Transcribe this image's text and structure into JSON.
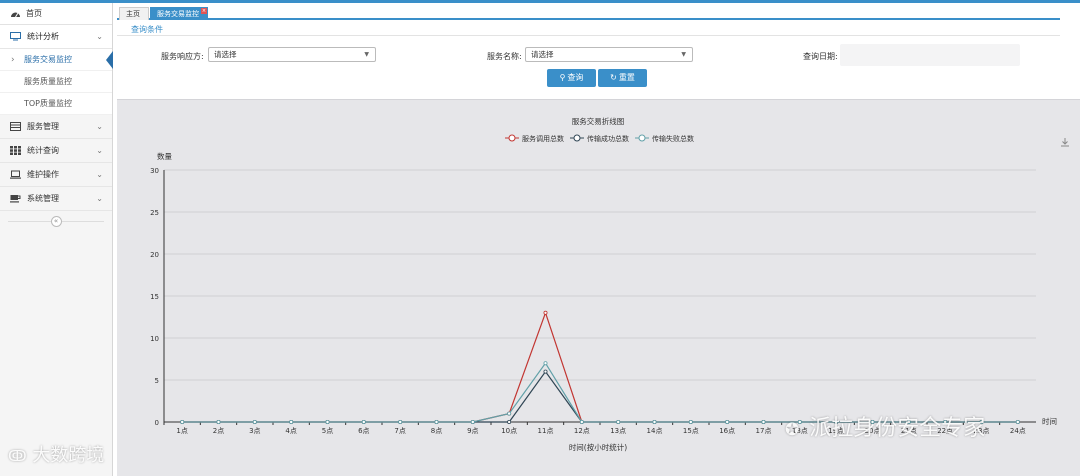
{
  "sidebar": {
    "home": "首页",
    "groups": [
      {
        "label": "统计分析",
        "icon": "monitor-icon",
        "expanded": true,
        "items": [
          "服务交易监控",
          "服务质量监控",
          "TOP质量监控"
        ]
      },
      {
        "label": "服务管理",
        "icon": "table-icon"
      },
      {
        "label": "统计查询",
        "icon": "grid-icon"
      },
      {
        "label": "维护操作",
        "icon": "laptop-icon"
      },
      {
        "label": "系统管理",
        "icon": "coffee-cup-icon"
      }
    ],
    "collapse": "«"
  },
  "tabs": [
    {
      "label": "主页"
    },
    {
      "label": "服务交易监控",
      "active": true,
      "close": "×"
    }
  ],
  "query": {
    "section_title": "查询条件",
    "responder_label": "服务响应方:",
    "responder_value": "请选择",
    "service_label": "服务名称:",
    "service_value": "请选择",
    "date_label": "查询日期:",
    "search_button": "查询",
    "reset_button": "重置"
  },
  "chart_data": {
    "type": "line",
    "title": "服务交易折线图",
    "ylabel": "数量",
    "xlabel": "时间(按小时统计)",
    "x_axis_name": "时间",
    "ylim": [
      0,
      30
    ],
    "yticks": [
      0,
      5,
      10,
      15,
      20,
      25,
      30
    ],
    "categories": [
      "1点",
      "2点",
      "3点",
      "4点",
      "5点",
      "6点",
      "7点",
      "8点",
      "9点",
      "10点",
      "11点",
      "12点",
      "13点",
      "14点",
      "15点",
      "16点",
      "17点",
      "18点",
      "19点",
      "20点",
      "21点",
      "22点",
      "23点",
      "24点"
    ],
    "series": [
      {
        "name": "服务调用总数",
        "color": "#c23531",
        "values": [
          0,
          0,
          0,
          0,
          0,
          0,
          0,
          0,
          0,
          1,
          13,
          0,
          0,
          0,
          0,
          0,
          0,
          0,
          0,
          0,
          0,
          0,
          0,
          0
        ]
      },
      {
        "name": "传输成功总数",
        "color": "#2f4554",
        "values": [
          0,
          0,
          0,
          0,
          0,
          0,
          0,
          0,
          0,
          0,
          6,
          0,
          0,
          0,
          0,
          0,
          0,
          0,
          0,
          0,
          0,
          0,
          0,
          0
        ]
      },
      {
        "name": "传输失败总数",
        "color": "#61a0a8",
        "values": [
          0,
          0,
          0,
          0,
          0,
          0,
          0,
          0,
          0,
          1,
          7,
          0,
          0,
          0,
          0,
          0,
          0,
          0,
          0,
          0,
          0,
          0,
          0,
          0
        ]
      }
    ],
    "legend_position": "top-center",
    "grid": true
  },
  "watermarks": {
    "left": "大数跨境",
    "right": "派拉身份安全专家"
  }
}
